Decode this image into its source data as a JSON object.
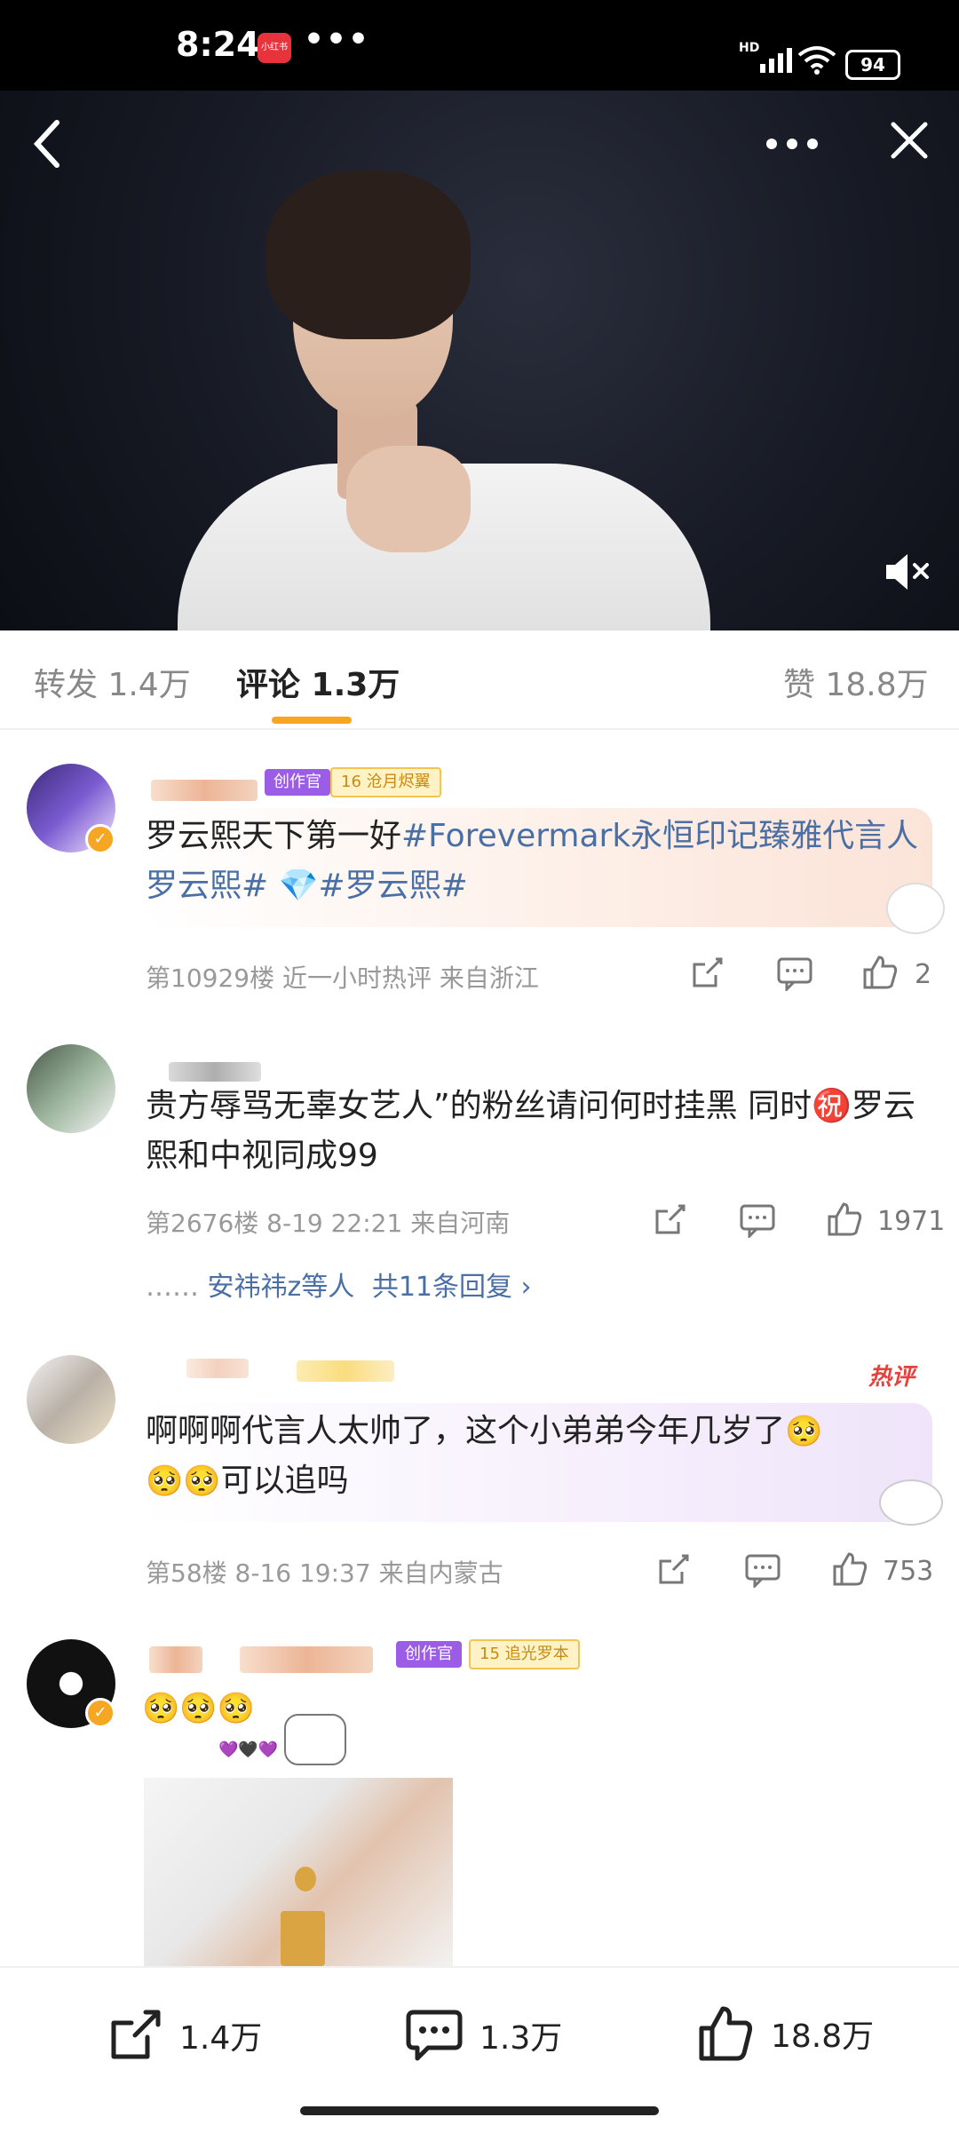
{
  "status_bar": {
    "time": "8:24",
    "app_badge": "小红书",
    "more": "•••",
    "signal": "HD",
    "battery": "94"
  },
  "hero": {
    "back_icon": "‹",
    "more_icon": "•••",
    "close_icon": "✕",
    "mute_icon": "🔇×"
  },
  "tabs": {
    "repost": "转发 1.4万",
    "comments": "评论 1.3万",
    "likes": "赞 18.8万"
  },
  "comments": [
    {
      "badges": [
        "创作官",
        "沧月烬翼"
      ],
      "badge_level": "16",
      "text": "罗云熙天下第一好",
      "hashtag1": "#Forevermark永恒印记臻雅代言人罗云熙#",
      "hashtag_emoji": "💎",
      "hashtag2": "#罗云熙#",
      "meta": "第10929楼  近一小时热评  来自浙江",
      "likes": "2"
    },
    {
      "text": "贵方辱骂无辜女艺人”的粉丝请问何时挂黑 同时㊗️罗云熙和中视同成99",
      "meta": "第2676楼  8-19 22:21  来自河南",
      "likes": "1971",
      "replies_prefix": "……",
      "replies_user": "安祎祎z等人",
      "replies_count": "共11条回复 ›"
    },
    {
      "hot": "热评",
      "text": "啊啊啊代言人太帅了，这个小弟弟今年几岁了",
      "text_end": "可以追吗",
      "meta": "第58楼  8-16 19:37  来自内蒙古",
      "likes": "753"
    },
    {
      "badges": [
        "创作官",
        "追光罗本"
      ],
      "badge_level": "15",
      "emoji_row": "🥺🥺🥺",
      "hearts": "💜🖤💜"
    }
  ],
  "bottom_bar": {
    "repost_count": "1.4万",
    "comment_count": "1.3万",
    "like_count": "18.8万"
  }
}
